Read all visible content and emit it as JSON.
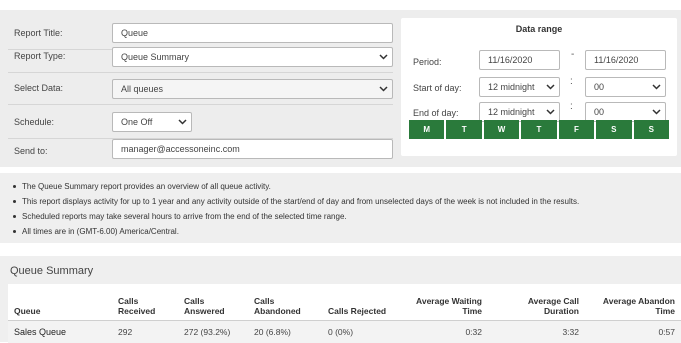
{
  "form": {
    "report_title": {
      "label": "Report Title:",
      "value": "Queue"
    },
    "report_type": {
      "label": "Report Type:",
      "value": "Queue Summary"
    },
    "select_data": {
      "label": "Select Data:",
      "value": "All queues"
    },
    "schedule": {
      "label": "Schedule:",
      "value": "One Off"
    },
    "send_to": {
      "label": "Send to:",
      "value": "manager@accessoneinc.com"
    }
  },
  "data_range": {
    "title": "Data range",
    "period_label": "Period:",
    "period_from": "11/16/2020",
    "period_separator": "-",
    "period_to": "11/16/2020",
    "start_label": "Start of day:",
    "start_hour": "12 midnight",
    "start_minute": "00",
    "end_label": "End of day:",
    "end_hour": "12 midnight",
    "end_minute": "00",
    "time_separator": ":",
    "days": [
      "M",
      "T",
      "W",
      "T",
      "F",
      "S",
      "S"
    ],
    "day_color": "#2a7a3b"
  },
  "notes": [
    "The Queue Summary report provides an overview of all queue activity.",
    "This report displays activity for up to 1 year and any activity outside of the start/end of day and from unselected days of the week is not included in the results.",
    "Scheduled reports may take several hours to arrive from the end of the selected time range.",
    "All times are in (GMT-6.00) America/Central."
  ],
  "summary": {
    "title": "Queue Summary",
    "columns": [
      "Queue",
      "Calls Received",
      "Calls Answered",
      "Calls Abandoned",
      "Calls Rejected",
      "Average Waiting Time",
      "Average Call Duration",
      "Average Abandon Time"
    ],
    "rows": [
      [
        "Sales Queue",
        "292",
        "272 (93.2%)",
        "20 (6.8%)",
        "0 (0%)",
        "0:32",
        "3:32",
        "0:57"
      ]
    ]
  }
}
